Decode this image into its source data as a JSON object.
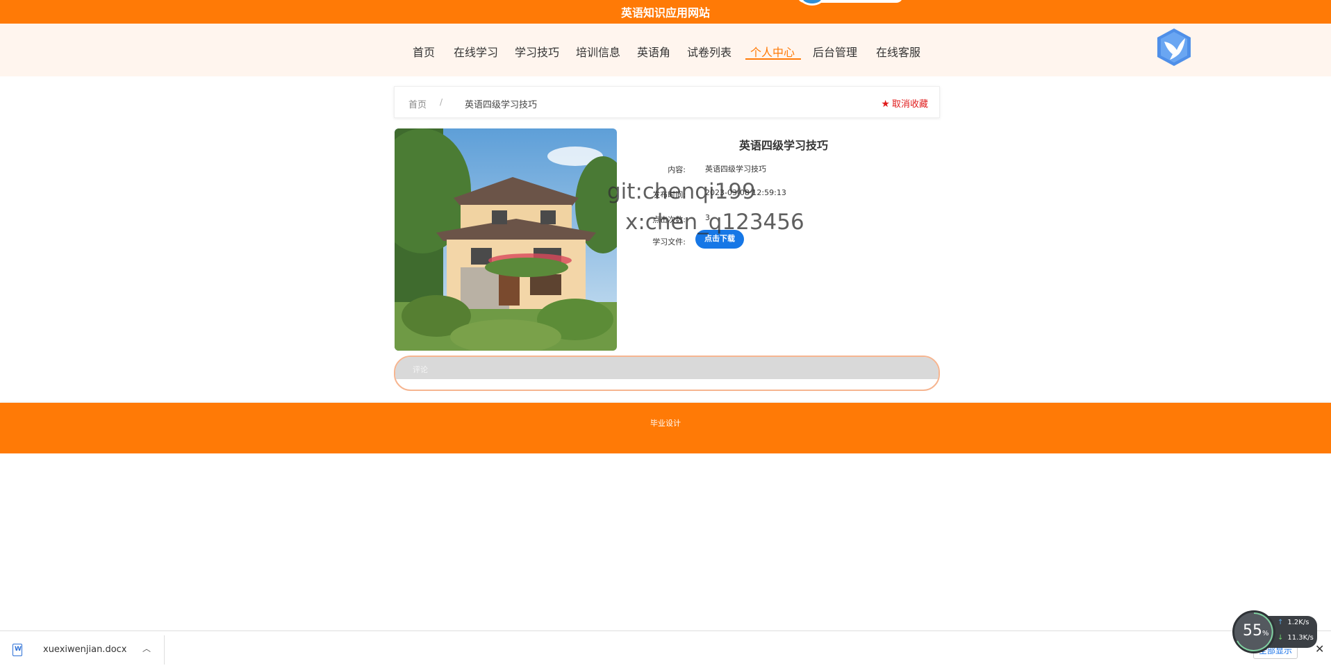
{
  "header": {
    "site_title": "英语知识应用网站",
    "nav_items": [
      "首页",
      "在线学习",
      "学习技巧",
      "培训信息",
      "英语角",
      "试卷列表",
      "个人中心",
      "后台管理",
      "在线客服"
    ],
    "active_nav": "个人中心"
  },
  "breadcrumb": {
    "home": "首页",
    "separator": "/",
    "current": "英语四级学习技巧",
    "unfavorite": "取消收藏"
  },
  "detail": {
    "title": "英语四级学习技巧",
    "content_label": "内容:",
    "content_value": "英语四级学习技巧",
    "time_label": "发布时间:",
    "time_value": "2023-03-08 12:59:13",
    "clicks_label": "点击次数:",
    "clicks_value": "3",
    "file_label": "学习文件:",
    "download_button": "点击下载"
  },
  "watermark": {
    "line1": "git:chenqi199",
    "line2": "x:chen_q123456"
  },
  "comments": {
    "label": "评论"
  },
  "footer": {
    "text": "毕业设计"
  },
  "download_bar": {
    "file_name": "xuexiwenjian.docx",
    "show_all": "全部显示"
  },
  "net_widget": {
    "percent": "55",
    "percent_unit": "%",
    "upload": "1.2K/s",
    "download": "11.3K/s"
  },
  "colors": {
    "accent": "#ff7a06",
    "favorite_red": "#e01b1b",
    "download_button": "#1677e6"
  }
}
